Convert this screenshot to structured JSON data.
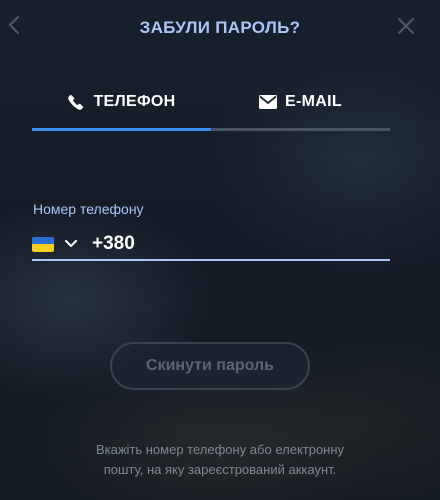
{
  "header": {
    "title": "ЗАБУЛИ ПАРОЛЬ?",
    "back_icon": "chevron-left-icon",
    "close_icon": "close-icon"
  },
  "tabs": [
    {
      "label": "ТЕЛЕФОН",
      "icon": "phone-icon",
      "active": true
    },
    {
      "label": "E-MAIL",
      "icon": "mail-icon",
      "active": false
    }
  ],
  "phone_field": {
    "label": "Номер телефону",
    "country_flag": "ukraine-flag",
    "value": "+380"
  },
  "reset_button": {
    "label": "Скинути пароль",
    "disabled": true
  },
  "hint": {
    "line1": "Вкажіть номер телефону або електронну",
    "line2": "пошту, на яку зареєстрований аккаунт."
  },
  "colors": {
    "accent_title": "#a9c6f5",
    "active_tab": "#3b8ef0",
    "inactive_tab": "#4a5563",
    "background": "#141c27"
  }
}
